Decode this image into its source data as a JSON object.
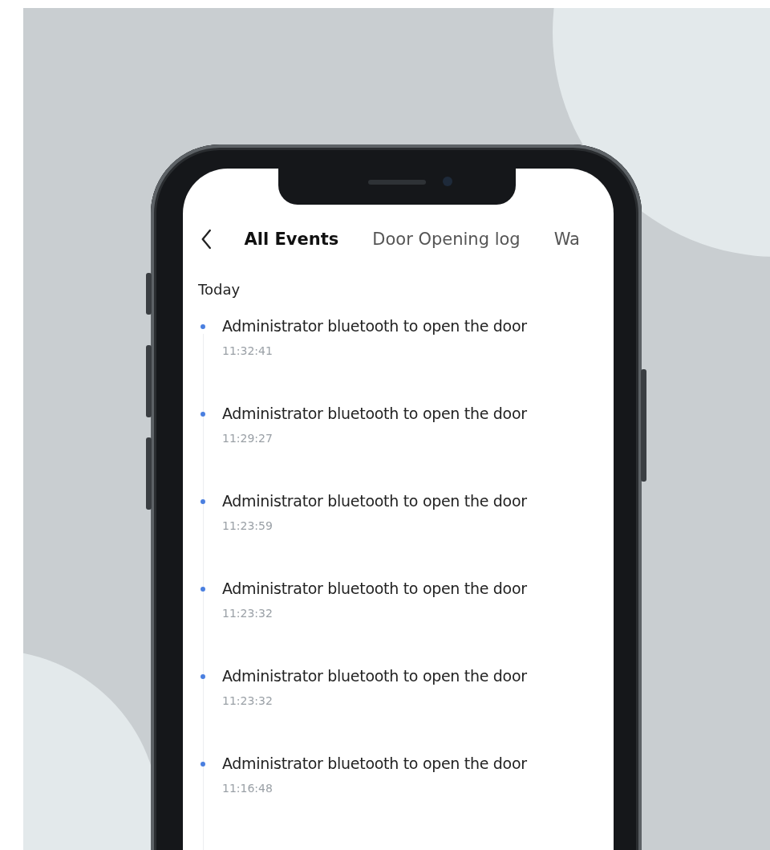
{
  "tabs": [
    {
      "label": "All Events",
      "selected": true
    },
    {
      "label": "Door Opening log",
      "selected": false
    },
    {
      "label": "Wa",
      "selected": false
    }
  ],
  "section": "Today",
  "events": [
    {
      "text": "Administrator bluetooth to open the door",
      "time": "11:32:41"
    },
    {
      "text": "Administrator bluetooth to open the door",
      "time": "11:29:27"
    },
    {
      "text": "Administrator bluetooth to open the door",
      "time": "11:23:59"
    },
    {
      "text": "Administrator bluetooth to open the door",
      "time": "11:23:32"
    },
    {
      "text": "Administrator bluetooth to open the door",
      "time": "11:23:32"
    },
    {
      "text": "Administrator bluetooth to open the door",
      "time": "11:16:48"
    }
  ]
}
